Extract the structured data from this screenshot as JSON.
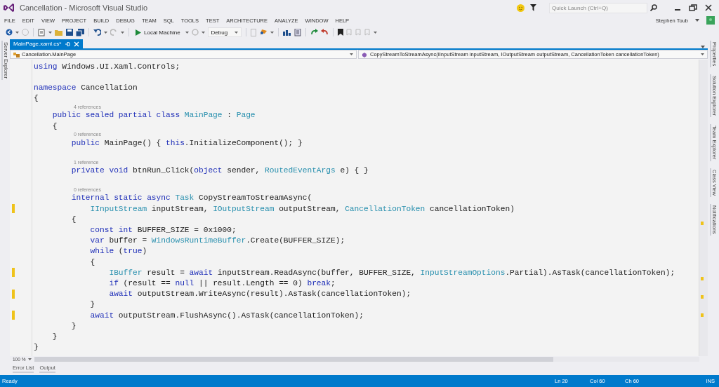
{
  "window": {
    "title": "Cancellation - Microsoft Visual Studio",
    "quick_launch": {
      "placeholder": "Quick Launch (Ctrl+Q)"
    },
    "user": "Stephen Toub"
  },
  "menu": [
    "FILE",
    "EDIT",
    "VIEW",
    "PROJECT",
    "BUILD",
    "DEBUG",
    "TEAM",
    "SQL",
    "TOOLS",
    "TEST",
    "ARCHITECTURE",
    "ANALYZE",
    "WINDOW",
    "HELP"
  ],
  "toolbar": {
    "target": "Local Machine",
    "configuration": "Debug"
  },
  "side_tabs_left": [
    "Server Explorer"
  ],
  "document_tabs": [
    {
      "label": "MainPage.xaml.cs*",
      "selected": true
    }
  ],
  "navigation": {
    "type": "Cancellation.MainPage",
    "member": "CopyStreamToStreamAsync(IInputStream inputStream, IOutputStream outputStream, CancellationToken cancellationToken)"
  },
  "editor": {
    "zoom": "100 %",
    "lines": [
      {
        "kind": "code",
        "changed": false,
        "tokens": [
          {
            "kind": "kw",
            "text": "using"
          },
          {
            "kind": "plain",
            "text": " Windows.UI.Xaml.Controls;"
          }
        ]
      },
      {
        "kind": "blank"
      },
      {
        "kind": "code",
        "changed": false,
        "tokens": [
          {
            "kind": "kw",
            "text": "namespace"
          },
          {
            "kind": "plain",
            "text": " Cancellation"
          }
        ]
      },
      {
        "kind": "code",
        "changed": false,
        "tokens": [
          {
            "kind": "plain",
            "text": "{"
          }
        ]
      },
      {
        "kind": "lens",
        "text": "4 references"
      },
      {
        "kind": "code",
        "changed": false,
        "tokens": [
          {
            "kind": "kw",
            "text": "    public sealed partial class"
          },
          {
            "kind": "type",
            "text": " MainPage"
          },
          {
            "kind": "plain",
            "text": " : "
          },
          {
            "kind": "type",
            "text": "Page"
          }
        ]
      },
      {
        "kind": "code",
        "changed": false,
        "tokens": [
          {
            "kind": "plain",
            "text": "    {"
          }
        ]
      },
      {
        "kind": "lens",
        "text": "0 references"
      },
      {
        "kind": "code",
        "changed": false,
        "tokens": [
          {
            "kind": "kw",
            "text": "        public"
          },
          {
            "kind": "plain",
            "text": " MainPage() { "
          },
          {
            "kind": "kw",
            "text": "this"
          },
          {
            "kind": "plain",
            "text": ".InitializeComponent(); }"
          }
        ]
      },
      {
        "kind": "blank"
      },
      {
        "kind": "lens",
        "text": "1 reference"
      },
      {
        "kind": "code",
        "changed": false,
        "tokens": [
          {
            "kind": "kw",
            "text": "        private void"
          },
          {
            "kind": "plain",
            "text": " btnRun_Click("
          },
          {
            "kind": "kw",
            "text": "object"
          },
          {
            "kind": "plain",
            "text": " sender, "
          },
          {
            "kind": "type",
            "text": "RoutedEventArgs"
          },
          {
            "kind": "plain",
            "text": " e) { }"
          }
        ]
      },
      {
        "kind": "blank"
      },
      {
        "kind": "lens",
        "text": "0 references"
      },
      {
        "kind": "code",
        "changed": false,
        "tokens": [
          {
            "kind": "kw",
            "text": "        internal static async"
          },
          {
            "kind": "type",
            "text": " Task"
          },
          {
            "kind": "plain",
            "text": " CopyStreamToStreamAsync("
          }
        ]
      },
      {
        "kind": "code",
        "changed": true,
        "tokens": [
          {
            "kind": "type",
            "text": "            IInputStream"
          },
          {
            "kind": "plain",
            "text": " inputStream, "
          },
          {
            "kind": "type",
            "text": "IOutputStream"
          },
          {
            "kind": "plain",
            "text": " outputStream, "
          },
          {
            "kind": "type",
            "text": "CancellationToken"
          },
          {
            "kind": "plain",
            "text": " cancellationToken)"
          }
        ]
      },
      {
        "kind": "code",
        "changed": false,
        "tokens": [
          {
            "kind": "plain",
            "text": "        {"
          }
        ]
      },
      {
        "kind": "code",
        "changed": false,
        "tokens": [
          {
            "kind": "kw",
            "text": "            const int"
          },
          {
            "kind": "plain",
            "text": " BUFFER_SIZE = 0x1000;"
          }
        ]
      },
      {
        "kind": "code",
        "changed": false,
        "tokens": [
          {
            "kind": "kw",
            "text": "            var"
          },
          {
            "kind": "plain",
            "text": " buffer = "
          },
          {
            "kind": "type",
            "text": "WindowsRuntimeBuffer"
          },
          {
            "kind": "plain",
            "text": ".Create(BUFFER_SIZE);"
          }
        ]
      },
      {
        "kind": "code",
        "changed": false,
        "tokens": [
          {
            "kind": "kw",
            "text": "            while"
          },
          {
            "kind": "plain",
            "text": " ("
          },
          {
            "kind": "kw",
            "text": "true"
          },
          {
            "kind": "plain",
            "text": ")"
          }
        ]
      },
      {
        "kind": "code",
        "changed": false,
        "tokens": [
          {
            "kind": "plain",
            "text": "            {"
          }
        ]
      },
      {
        "kind": "code",
        "changed": true,
        "tokens": [
          {
            "kind": "type",
            "text": "                IBuffer"
          },
          {
            "kind": "plain",
            "text": " result = "
          },
          {
            "kind": "kw",
            "text": "await"
          },
          {
            "kind": "plain",
            "text": " inputStream.ReadAsync(buffer, BUFFER_SIZE, "
          },
          {
            "kind": "type",
            "text": "InputStreamOptions"
          },
          {
            "kind": "plain",
            "text": ".Partial).AsTask(cancellationToken);"
          }
        ]
      },
      {
        "kind": "code",
        "changed": false,
        "tokens": [
          {
            "kind": "kw",
            "text": "                if"
          },
          {
            "kind": "plain",
            "text": " (result == "
          },
          {
            "kind": "kw",
            "text": "null"
          },
          {
            "kind": "plain",
            "text": " || result.Length == 0) "
          },
          {
            "kind": "kw",
            "text": "break"
          },
          {
            "kind": "plain",
            "text": ";"
          }
        ]
      },
      {
        "kind": "code",
        "changed": true,
        "tokens": [
          {
            "kind": "kw",
            "text": "                await"
          },
          {
            "kind": "plain",
            "text": " outputStream.WriteAsync(result).AsTask(cancellationToken);"
          }
        ]
      },
      {
        "kind": "code",
        "changed": false,
        "tokens": [
          {
            "kind": "plain",
            "text": "            }"
          }
        ]
      },
      {
        "kind": "code",
        "changed": true,
        "tokens": [
          {
            "kind": "kw",
            "text": "            await"
          },
          {
            "kind": "plain",
            "text": " outputStream.FlushAsync().AsTask(cancellationToken);"
          }
        ]
      },
      {
        "kind": "code",
        "changed": false,
        "tokens": [
          {
            "kind": "plain",
            "text": "        }"
          }
        ]
      },
      {
        "kind": "code",
        "changed": false,
        "tokens": [
          {
            "kind": "plain",
            "text": "    }"
          }
        ]
      },
      {
        "kind": "code",
        "changed": false,
        "tokens": [
          {
            "kind": "plain",
            "text": "}"
          }
        ]
      }
    ]
  },
  "side_tabs_right": [
    "Properties",
    "Solution Explorer",
    "Team Explorer",
    "Class View",
    "Notifications"
  ],
  "tool_tabs": [
    "Error List",
    "Output"
  ],
  "status_bar": {
    "message": "Ready",
    "line": "Ln 20",
    "column": "Col 60",
    "char": "Ch 60",
    "mode": "INS"
  }
}
